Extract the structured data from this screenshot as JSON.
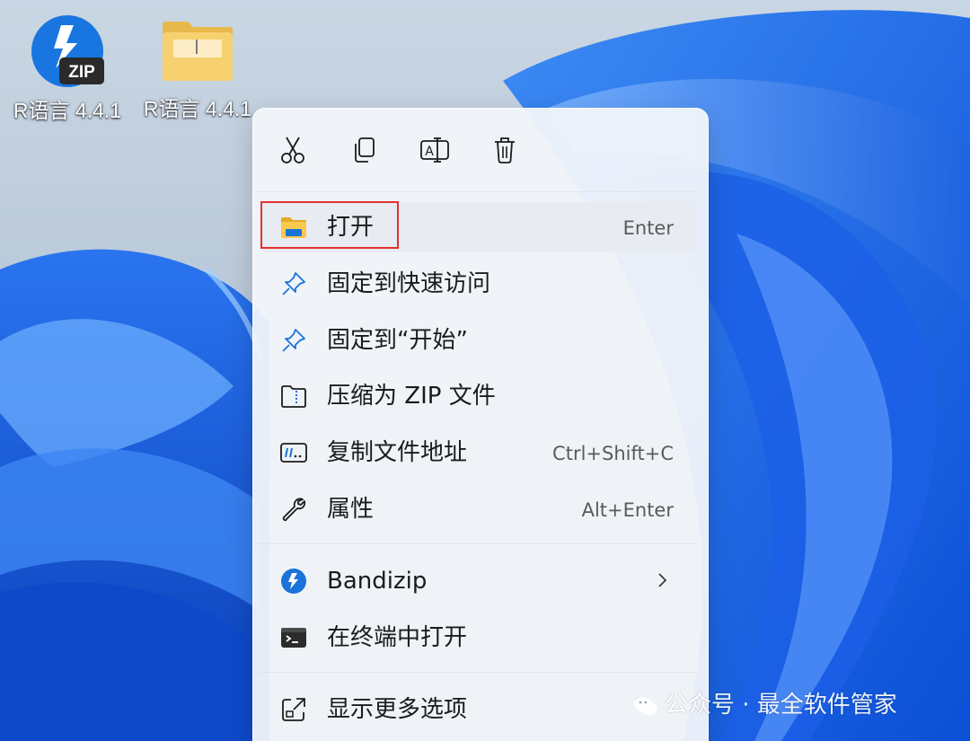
{
  "desktop": {
    "icons": [
      {
        "label": "R语言 4.4.1",
        "kind": "zip-archive",
        "badge": "ZIP"
      },
      {
        "label": "R语言 4.4.1",
        "kind": "folder"
      }
    ]
  },
  "context_menu": {
    "toolbar": [
      {
        "name": "cut",
        "icon": "scissors-icon"
      },
      {
        "name": "copy",
        "icon": "copy-icon"
      },
      {
        "name": "rename",
        "icon": "rename-icon"
      },
      {
        "name": "delete",
        "icon": "trash-icon"
      }
    ],
    "items": [
      {
        "label": "打开",
        "shortcut": "Enter",
        "icon": "folder-icon",
        "highlighted": true
      },
      {
        "label": "固定到快速访问",
        "shortcut": "",
        "icon": "pin-icon"
      },
      {
        "label": "固定到“开始”",
        "shortcut": "",
        "icon": "pin-icon"
      },
      {
        "label": "压缩为 ZIP 文件",
        "shortcut": "",
        "icon": "zip-folder-icon"
      },
      {
        "label": "复制文件地址",
        "shortcut": "Ctrl+Shift+C",
        "icon": "copy-path-icon"
      },
      {
        "label": "属性",
        "shortcut": "Alt+Enter",
        "icon": "wrench-icon"
      },
      {
        "label": "Bandizip",
        "shortcut": "",
        "icon": "bandizip-icon",
        "submenu": true
      },
      {
        "label": "在终端中打开",
        "shortcut": "",
        "icon": "terminal-icon"
      },
      {
        "label": "显示更多选项",
        "shortcut": "",
        "icon": "more-options-icon"
      }
    ]
  },
  "watermark": {
    "text": "公众号 · 最全软件管家"
  },
  "colors": {
    "highlight_box": "#e53030",
    "accent": "#1a73d9",
    "menu_bg": "#f2f5fa"
  }
}
